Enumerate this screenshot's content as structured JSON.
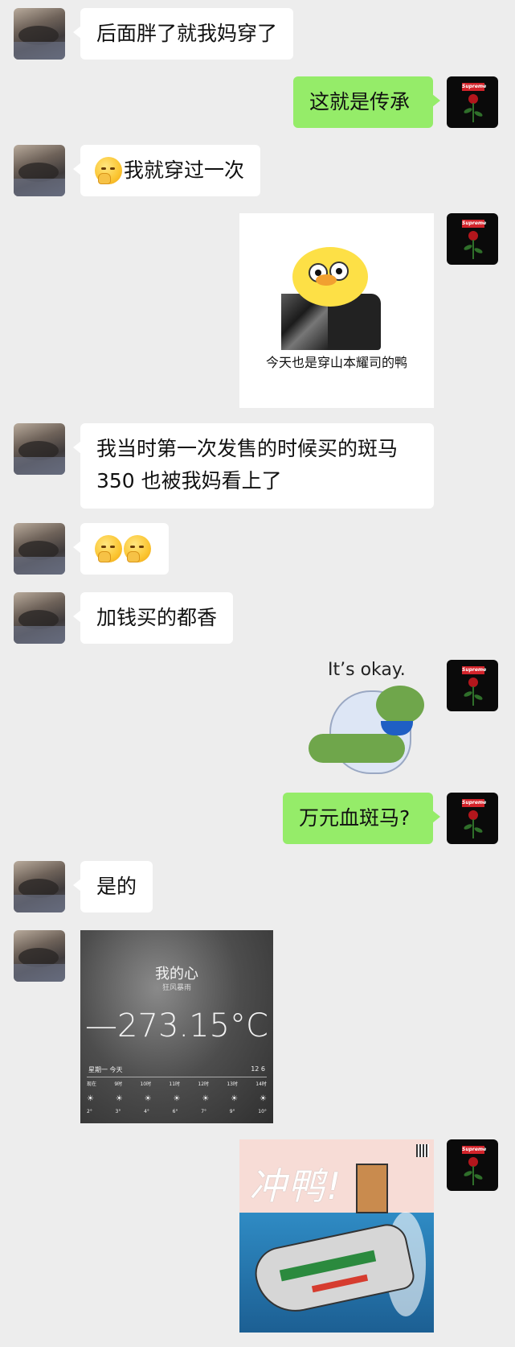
{
  "messages": [
    {
      "side": "left",
      "type": "text",
      "text": "后面胖了就我妈穿了"
    },
    {
      "side": "right",
      "type": "text",
      "text": "这就是传承"
    },
    {
      "side": "left",
      "type": "text",
      "text": "我就穿过一次",
      "emoji": "thinking-emoji"
    },
    {
      "side": "right",
      "type": "sticker",
      "caption": "今天也是穿山本耀司的鸭"
    },
    {
      "side": "left",
      "type": "text",
      "lines": [
        "我当时第一次发售的时候买的斑马",
        "350 也被我妈看上了"
      ]
    },
    {
      "side": "left",
      "type": "emoji",
      "emoji": [
        "thinking-emoji",
        "thinking-emoji"
      ]
    },
    {
      "side": "left",
      "type": "text",
      "text": "加钱买的都香"
    },
    {
      "side": "right",
      "type": "sticker",
      "caption": "It’s okay."
    },
    {
      "side": "right",
      "type": "text",
      "text": "万元血斑马?"
    },
    {
      "side": "left",
      "type": "text",
      "text": "是的"
    },
    {
      "side": "left",
      "type": "image",
      "weather": {
        "title": "我的心",
        "subtitle": "狂风暴雨",
        "temperature": "—273.15°C",
        "day": "星期一  今天",
        "high_low": "12    6",
        "hours": [
          "现在",
          "9时",
          "10时",
          "11时",
          "12时",
          "13时",
          "14时"
        ],
        "temps": [
          "2°",
          "3°",
          "4°",
          "6°",
          "7°",
          "9°",
          "10°"
        ]
      }
    },
    {
      "side": "right",
      "type": "sticker",
      "caption": "冲鸭!"
    }
  ],
  "avatars": {
    "left": "cat-avatar",
    "right": "supreme-rose-avatar",
    "right_logo": "Supreme"
  },
  "colors": {
    "background": "#ededed",
    "green_bubble": "#95ec69",
    "white_bubble": "#ffffff"
  }
}
